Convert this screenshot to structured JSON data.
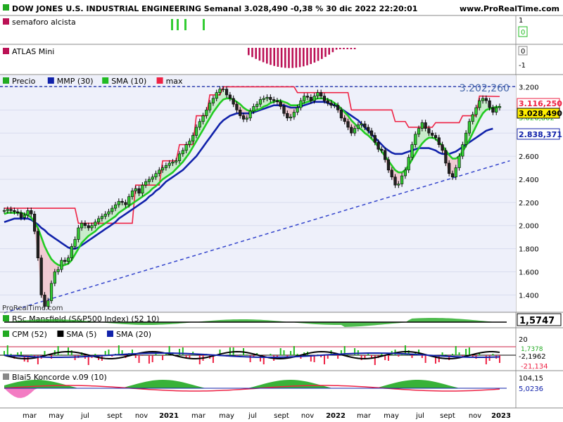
{
  "header": {
    "title": "DOW JONES U.S. INDUSTRIAL ENGINEERING Semanal 3.028,490 -0,38 % 30 dic 2022 22:20:01",
    "brand": "www.ProRealTime.com",
    "watermark": "ProRealTime.com"
  },
  "panels": {
    "semaforo": {
      "label": "semaforo alcista",
      "ticks": [
        "1",
        "0"
      ],
      "value_badge": "0",
      "color": "#22bb22"
    },
    "atlas": {
      "label": "ATLAS Mini",
      "ticks": [
        "0",
        "-1"
      ],
      "value_badge": "0",
      "color": "#bb1155"
    },
    "main": {
      "legend": [
        {
          "label": "Precio",
          "color": "#22aa22"
        },
        {
          "label": "MMP (30)",
          "color": "#1122aa"
        },
        {
          "label": "SMA (10)",
          "color": "#22bb22"
        },
        {
          "label": "max",
          "color": "#ee2244"
        }
      ],
      "hline_label": "3.202,260",
      "price_labels": {
        "max": "3.116,250",
        "last": "3.028,490",
        "sma_hidden": "3.026,802",
        "mmp": "2.838,371"
      },
      "ticks": [
        "3.200",
        "3.000",
        "2.800",
        "2.600",
        "2.400",
        "2.200",
        "2.000",
        "1.800",
        "1.600",
        "1.400"
      ]
    },
    "rsc": {
      "label": "RSc Mansfield (S&P500 Index) (52 10)",
      "value": "1,5747"
    },
    "cpm": {
      "legend": [
        {
          "label": "CPM (52)",
          "color": "#22aa22"
        },
        {
          "label": "SMA (5)",
          "color": "#000000"
        },
        {
          "label": "SMA (20)",
          "color": "#1122aa"
        }
      ],
      "ticks": [
        "20"
      ],
      "values": {
        "v1": "1,7378",
        "v2": "-2,1962",
        "v3": "-21,134"
      }
    },
    "blai": {
      "label": "Blai5 Koncorde v.09 (10)",
      "values": {
        "v1": "104,15",
        "v2": "5,0236"
      }
    }
  },
  "xaxis": {
    "labels": [
      "mar",
      "may",
      "jul",
      "sept",
      "nov",
      "2021",
      "mar",
      "may",
      "jul",
      "sept",
      "nov",
      "2022",
      "mar",
      "may",
      "jul",
      "sept",
      "nov",
      "2023"
    ]
  },
  "chart_data": {
    "type": "candlestick",
    "title": "DOW JONES U.S. INDUSTRIAL ENGINEERING Semanal",
    "ylim": [
      1250,
      3300
    ],
    "hline": 3202.26,
    "trendline": [
      [
        0,
        1245
      ],
      [
        150,
        2560
      ]
    ],
    "series": [
      {
        "name": "Precio",
        "values": [
          2130,
          2140,
          2130,
          2120,
          2110,
          2070,
          2090,
          2130,
          2100,
          1950,
          1720,
          1400,
          1300,
          1350,
          1500,
          1600,
          1620,
          1700,
          1690,
          1720,
          1820,
          1880,
          1980,
          2020,
          2000,
          1980,
          2000,
          2030,
          2060,
          2080,
          2100,
          2120,
          2150,
          2180,
          2210,
          2200,
          2180,
          2250,
          2300,
          2320,
          2280,
          2350,
          2380,
          2400,
          2420,
          2450,
          2480,
          2500,
          2520,
          2540,
          2550,
          2560,
          2620,
          2650,
          2700,
          2730,
          2780,
          2850,
          2900,
          2950,
          3000,
          3060,
          3100,
          3150,
          3180,
          3180,
          3130,
          3100,
          3050,
          3000,
          2950,
          2920,
          2930,
          2990,
          3030,
          3050,
          3090,
          3100,
          3110,
          3090,
          3080,
          3070,
          3030,
          2970,
          2930,
          2940,
          2980,
          3020,
          3080,
          3120,
          3110,
          3080,
          3120,
          3150,
          3120,
          3080,
          3060,
          3040,
          3040,
          3000,
          2930,
          2900,
          2850,
          2800,
          2840,
          2870,
          2880,
          2850,
          2820,
          2780,
          2720,
          2660,
          2650,
          2570,
          2480,
          2420,
          2350,
          2360,
          2430,
          2480,
          2590,
          2700,
          2790,
          2840,
          2890,
          2840,
          2800,
          2780,
          2760,
          2700,
          2650,
          2540,
          2450,
          2420,
          2500,
          2600,
          2700,
          2800,
          2900,
          2960,
          3020,
          3080,
          3100,
          3080,
          3020,
          2980,
          3020,
          3030
        ]
      },
      {
        "name": "MMP (30)",
        "values": [
          2030,
          2040,
          2050,
          2060,
          2060,
          2060,
          2060,
          2060,
          2050,
          2030,
          2010,
          1980,
          1960,
          1930,
          1910,
          1890,
          1870,
          1850,
          1830,
          1810,
          1800,
          1800,
          1810,
          1830,
          1850,
          1870,
          1890,
          1910,
          1930,
          1950,
          1970,
          1990,
          2010,
          2030,
          2060,
          2080,
          2100,
          2120,
          2140,
          2160,
          2180,
          2200,
          2220,
          2250,
          2270,
          2300,
          2320,
          2350,
          2380,
          2400,
          2420,
          2440,
          2460,
          2480,
          2510,
          2540,
          2570,
          2600,
          2640,
          2680,
          2720,
          2760,
          2800,
          2840,
          2880,
          2910,
          2930,
          2950,
          2960,
          2970,
          2970,
          2970,
          2970,
          2970,
          2980,
          2990,
          3000,
          3010,
          3020,
          3030,
          3040,
          3040,
          3040,
          3040,
          3030,
          3020,
          3020,
          3020,
          3030,
          3040,
          3050,
          3060,
          3070,
          3070,
          3070,
          3070,
          3060,
          3050,
          3040,
          3030,
          3010,
          2990,
          2970,
          2950,
          2930,
          2910,
          2880,
          2850,
          2820,
          2790,
          2760,
          2730,
          2700,
          2670,
          2650,
          2630,
          2620,
          2620,
          2620,
          2630,
          2640,
          2650,
          2660,
          2670,
          2670,
          2670,
          2670,
          2660,
          2650,
          2630,
          2620,
          2620,
          2620,
          2630,
          2640,
          2660,
          2680,
          2700,
          2720,
          2740,
          2760,
          2780,
          2800,
          2820,
          2830,
          2838
        ]
      },
      {
        "name": "SMA (10)",
        "values": [
          2100,
          2110,
          2110,
          2110,
          2110,
          2110,
          2100,
          2090,
          2070,
          2030,
          1980,
          1900,
          1820,
          1760,
          1710,
          1680,
          1660,
          1650,
          1660,
          1670,
          1700,
          1750,
          1800,
          1850,
          1880,
          1910,
          1930,
          1950,
          1980,
          2000,
          2020,
          2040,
          2060,
          2080,
          2110,
          2130,
          2150,
          2170,
          2190,
          2210,
          2230,
          2250,
          2270,
          2290,
          2320,
          2340,
          2370,
          2400,
          2420,
          2440,
          2460,
          2490,
          2520,
          2550,
          2590,
          2630,
          2680,
          2730,
          2780,
          2830,
          2880,
          2930,
          2980,
          3020,
          3060,
          3090,
          3100,
          3100,
          3090,
          3070,
          3050,
          3020,
          3000,
          2990,
          2990,
          3000,
          3010,
          3030,
          3040,
          3060,
          3070,
          3080,
          3080,
          3070,
          3060,
          3040,
          3040,
          3040,
          3050,
          3060,
          3070,
          3080,
          3090,
          3100,
          3100,
          3100,
          3090,
          3080,
          3060,
          3040,
          3010,
          2980,
          2950,
          2910,
          2880,
          2850,
          2830,
          2800,
          2780,
          2750,
          2720,
          2680,
          2640,
          2600,
          2560,
          2520,
          2480,
          2460,
          2460,
          2480,
          2520,
          2570,
          2620,
          2670,
          2710,
          2740,
          2760,
          2760,
          2750,
          2720,
          2690,
          2650,
          2610,
          2580,
          2580,
          2600,
          2640,
          2690,
          2740,
          2800,
          2860,
          2920,
          2970,
          3000,
          3010,
          3020,
          3025,
          3027
        ]
      },
      {
        "name": "max",
        "values": [
          2150,
          2150,
          2150,
          2150,
          2150,
          2150,
          2150,
          2150,
          2150,
          2150,
          2150,
          2150,
          2150,
          2150,
          2150,
          2150,
          2150,
          2150,
          2150,
          2150,
          2150,
          2150,
          2150,
          2150,
          2150,
          2150,
          2150,
          2150,
          2150,
          2150,
          2150,
          2150,
          2150,
          2150,
          2150,
          2150,
          2150,
          2150,
          2150,
          2150,
          2150,
          2150,
          2150,
          2150,
          2150,
          2150,
          2150,
          2150,
          2150,
          2150,
          2150,
          2150,
          2150,
          2150,
          2150,
          2150,
          2150,
          2150,
          2150,
          2150,
          2150,
          2150,
          2150,
          2150,
          2150,
          2150,
          2150,
          2150,
          2150,
          2150,
          2150,
          2150,
          2150,
          2150,
          2150,
          2150,
          2150,
          2150,
          2150,
          2150,
          2150,
          2150,
          2150,
          2150,
          2150,
          2150,
          2150,
          2150,
          2150,
          2150,
          2150,
          2150,
          2150,
          2150,
          2150,
          2150,
          2150,
          2150,
          2150,
          2150,
          2150,
          2150,
          2150,
          2150,
          2150,
          2150,
          2150,
          2150,
          2150,
          2150,
          2150,
          2150,
          2150,
          2150,
          2150,
          2150,
          2150,
          2150,
          2150,
          2150,
          2150,
          2150,
          2150,
          2150,
          2150,
          2150,
          2150,
          2150,
          2150,
          2150,
          2150,
          2150,
          2150,
          2150,
          2150,
          2150,
          2150,
          2150,
          2150,
          2150,
          2150,
          2150,
          2150,
          2150,
          2150,
          2150,
          2150,
          2150
        ]
      }
    ],
    "max_line_override": [
      [
        0,
        2150
      ],
      [
        21,
        2150
      ],
      [
        22,
        2020
      ],
      [
        38,
        2020
      ],
      [
        39,
        2350
      ],
      [
        46,
        2350
      ],
      [
        47,
        2560
      ],
      [
        51,
        2560
      ],
      [
        52,
        2700
      ],
      [
        56,
        2700
      ],
      [
        57,
        2950
      ],
      [
        60,
        2950
      ],
      [
        61,
        3130
      ],
      [
        64,
        3130
      ],
      [
        65,
        3200
      ],
      [
        86,
        3200
      ],
      [
        87,
        3150
      ],
      [
        102,
        3150
      ],
      [
        103,
        3000
      ],
      [
        115,
        3000
      ],
      [
        116,
        2900
      ],
      [
        119,
        2900
      ],
      [
        120,
        2850
      ],
      [
        127,
        2850
      ],
      [
        128,
        2890
      ],
      [
        135,
        2890
      ],
      [
        136,
        2950
      ],
      [
        140,
        2950
      ],
      [
        141,
        3120
      ],
      [
        147,
        3116
      ]
    ]
  }
}
